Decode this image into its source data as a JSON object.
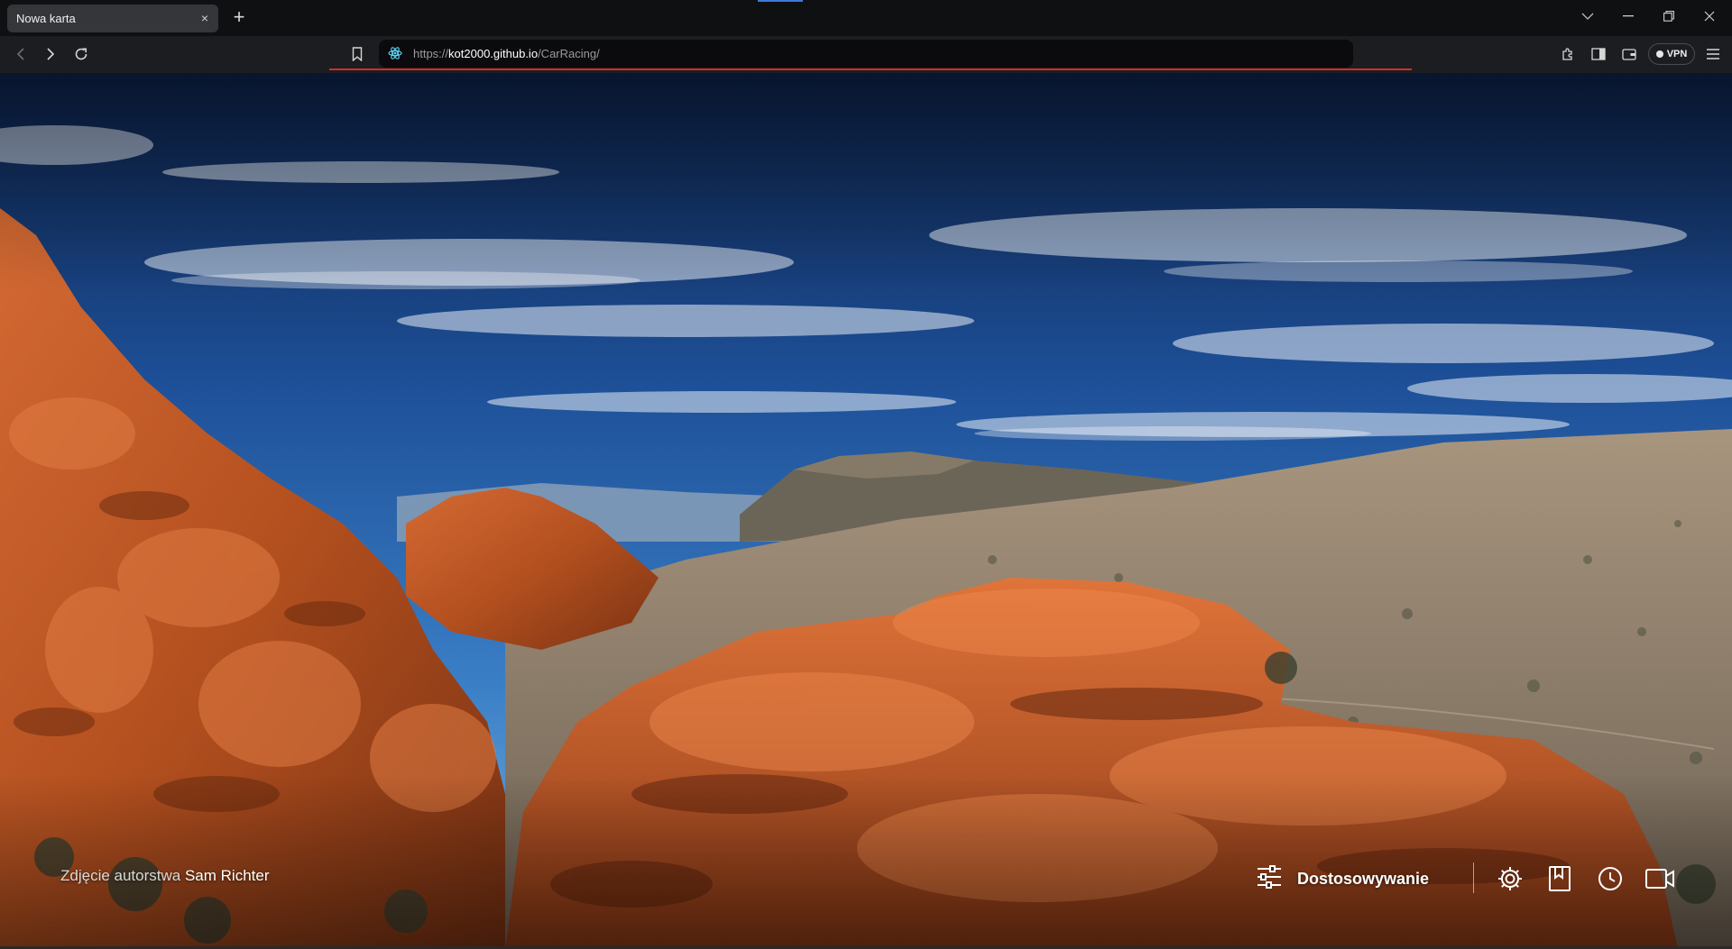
{
  "tab": {
    "title": "Nowa karta",
    "close_glyph": "×"
  },
  "new_tab_glyph": "+",
  "address_bar": {
    "url_scheme": "https://",
    "url_host": "kot2000.github.io",
    "url_path": "/CarRacing/",
    "site_icon": "react-atom-icon"
  },
  "toolbar": {
    "vpn_label": "VPN"
  },
  "page": {
    "credit_prefix": "Zdjęcie autorstwa",
    "credit_author": "Sam Richter",
    "customize_label": "Dostosowywanie"
  },
  "colors": {
    "loading_bar": "#d22c2c",
    "tab_bg": "#34363a",
    "address_bg": "#0b0b0d",
    "accent": "#3d7bd9"
  }
}
